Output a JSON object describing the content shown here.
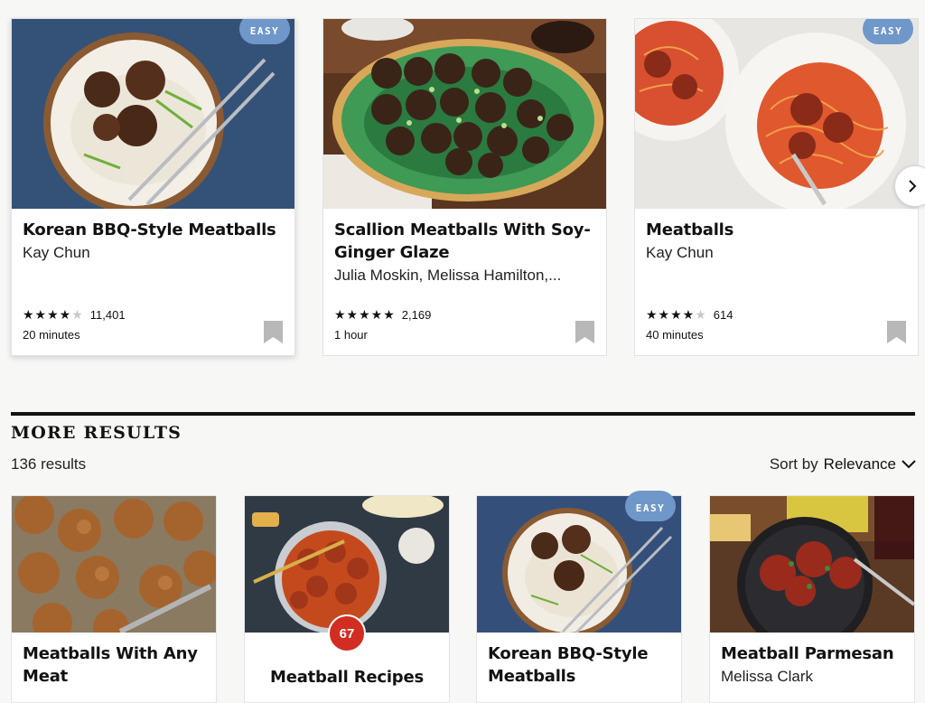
{
  "featured": [
    {
      "title": "Korean BBQ-Style Meatballs",
      "byline": "Kay Chun",
      "stars": "★★★★",
      "stars_off": "★",
      "rating_count": "11,401",
      "time": "20 minutes",
      "badge": "EASY"
    },
    {
      "title": "Scallion Meatballs With Soy-Ginger Glaze",
      "byline": "Julia Moskin, Melissa Hamilton,...",
      "stars": "★★★★★",
      "stars_off": "",
      "rating_count": "2,169",
      "time": "1 hour",
      "badge": ""
    },
    {
      "title": "Meatballs",
      "byline": "Kay Chun",
      "stars": "★★★★",
      "stars_off": "★",
      "rating_count": "614",
      "time": "40 minutes",
      "badge": "EASY"
    }
  ],
  "more_results": {
    "heading": "MORE RESULTS",
    "count": "136 results",
    "sort_prefix": "Sort by",
    "sort_value": "Relevance"
  },
  "grid": [
    {
      "title": "Meatballs With Any Meat",
      "byline": ""
    },
    {
      "title": "Meatball Recipes",
      "badge": "67"
    },
    {
      "title": "Korean BBQ-Style Meatballs",
      "badge": "EASY"
    },
    {
      "title": "Meatball Parmesan",
      "byline": "Melissa Clark"
    }
  ],
  "icons": {
    "next": "chevron-right-icon",
    "sort": "chevron-down-icon",
    "bookmark": "bookmark-icon"
  },
  "colors": {
    "easy_badge": "#6f97c9",
    "count_badge": "#d22d22"
  }
}
